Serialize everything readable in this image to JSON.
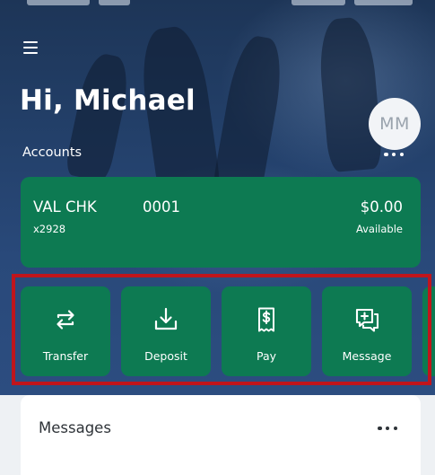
{
  "header": {
    "greeting": "Hi, Michael",
    "avatar_initials": "MM",
    "menu_icon": "hamburger-menu-icon"
  },
  "accounts": {
    "label": "Accounts",
    "more_icon": "more-dots-icon",
    "card": {
      "name": "VAL CHK",
      "number": "0001",
      "masked_number": "x2928",
      "balance": "$0.00",
      "balance_label": "Available"
    }
  },
  "actions": [
    {
      "label": "Transfer",
      "icon": "transfer-arrows-icon"
    },
    {
      "label": "Deposit",
      "icon": "deposit-download-icon"
    },
    {
      "label": "Pay",
      "icon": "dollar-receipt-icon"
    },
    {
      "label": "Message",
      "icon": "message-plus-icon"
    },
    {
      "label": "",
      "icon": ""
    }
  ],
  "messages": {
    "title": "Messages",
    "more_icon": "more-dots-icon"
  },
  "colors": {
    "hero_bg": "#1d3557",
    "accent_green": "#0d7a52",
    "highlight_red": "#c0151c",
    "page_bg": "#eef1f4"
  }
}
